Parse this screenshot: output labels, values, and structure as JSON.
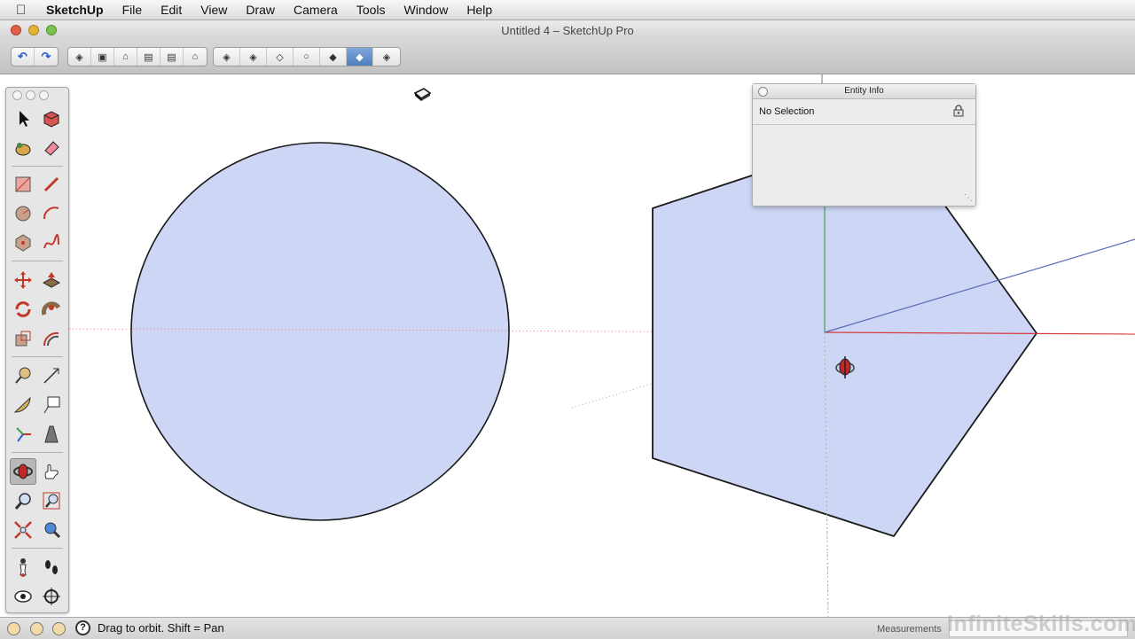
{
  "menubar": {
    "app_name": "SketchUp",
    "items": [
      "File",
      "Edit",
      "View",
      "Draw",
      "Camera",
      "Tools",
      "Window",
      "Help"
    ]
  },
  "window": {
    "title": "Untitled 4 – SketchUp Pro"
  },
  "toolbar": {
    "undo_icon": "undo-icon",
    "redo_icon": "redo-icon",
    "view_buttons": [
      "iso-view",
      "top-view",
      "front-view",
      "right-view",
      "back-view",
      "left-view"
    ],
    "style_buttons": [
      "xray",
      "back-edges",
      "wireframe",
      "hidden-line",
      "shaded",
      "shaded-with-textures",
      "monochrome"
    ],
    "active_style": "shaded-with-textures"
  },
  "palette": {
    "active_tool": "orbit",
    "tools": [
      "select",
      "make-component",
      "paint-bucket",
      "eraser",
      "rectangle",
      "line",
      "circle",
      "arc",
      "polygon",
      "freehand",
      "move",
      "push-pull",
      "rotate",
      "follow-me",
      "scale",
      "offset",
      "tape-measure",
      "dimension",
      "protractor",
      "text",
      "axes",
      "3d-text",
      "orbit",
      "pan",
      "zoom",
      "zoom-window",
      "zoom-extents",
      "previous",
      "position-camera",
      "walk",
      "look-around",
      "section-plane"
    ]
  },
  "entity_info": {
    "title": "Entity Info",
    "selection": "No Selection"
  },
  "statusbar": {
    "message": "Drag to orbit.  Shift = Pan",
    "measurements_label": "Measurements",
    "measurements_value": ""
  },
  "watermark": "InfiniteSkills.com",
  "colors": {
    "face_fill": "#cdd6f4",
    "edge": "#1a1a1a",
    "axis_red": "#d43a3a",
    "axis_green": "#3aa64a",
    "axis_blue": "#5b6bb5"
  }
}
